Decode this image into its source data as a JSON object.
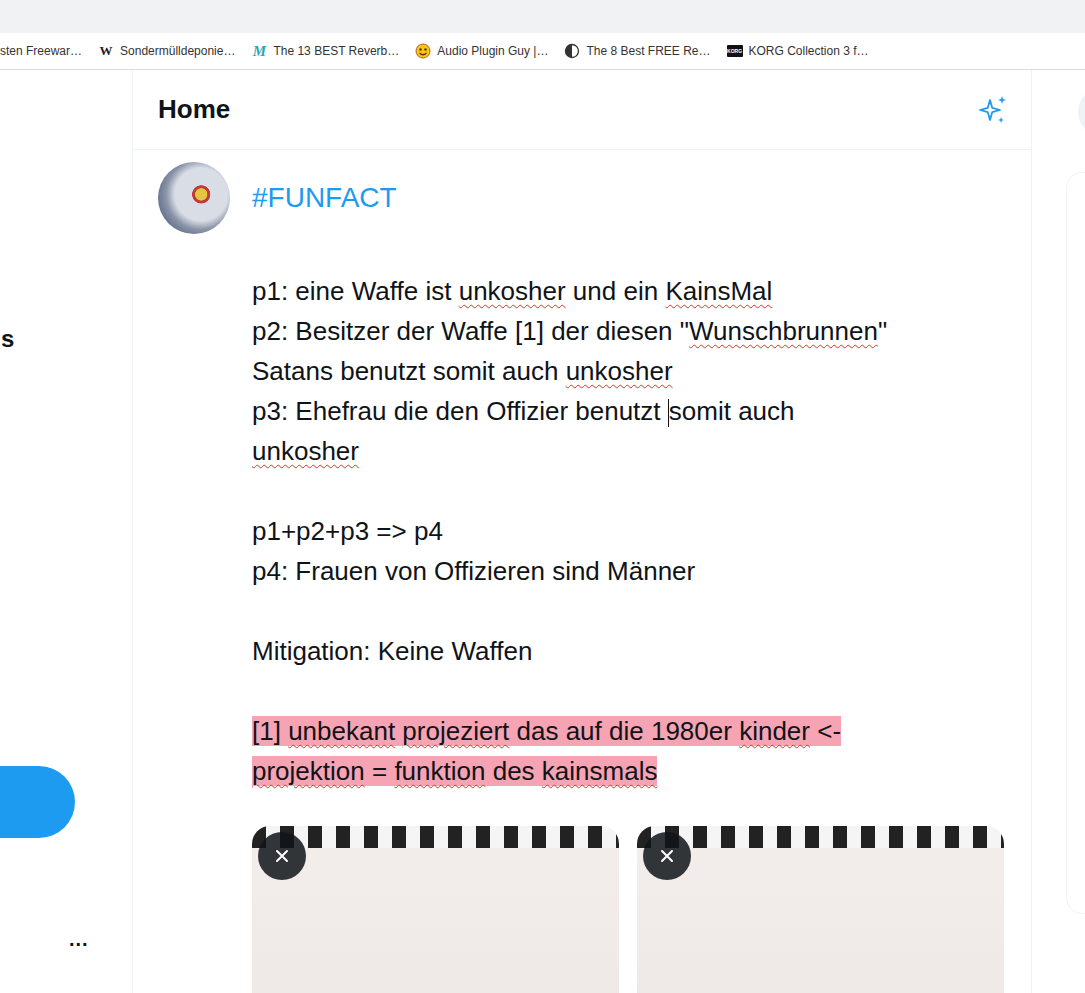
{
  "browser": {
    "bookmarks": [
      {
        "label": "sten Freewar…",
        "kind": "none",
        "icon_text": ""
      },
      {
        "label": "Sondermülldeponie…",
        "kind": "wikipedia",
        "icon_text": "W"
      },
      {
        "label": "The 13 BEST Reverb…",
        "kind": "logo-m",
        "icon_text": "M"
      },
      {
        "label": "Audio Plugin Guy |…",
        "kind": "emoji",
        "icon_text": ""
      },
      {
        "label": "The 8 Best FREE Re…",
        "kind": "half-moon",
        "icon_text": ""
      },
      {
        "label": "KORG Collection 3 f…",
        "kind": "korg",
        "icon_text": "KORG"
      }
    ]
  },
  "left_nav": {
    "partial_label": "s",
    "more": "..."
  },
  "header": {
    "title": "Home"
  },
  "post": {
    "hashtag": "#FUNFACT",
    "lines": [
      {
        "highlighted": false,
        "segments": [
          {
            "text": "p1: eine Waffe ist ",
            "misspelled": false,
            "caret": false
          },
          {
            "text": "unkosher",
            "misspelled": true,
            "caret": false
          },
          {
            "text": " und ein ",
            "misspelled": false,
            "caret": false
          },
          {
            "text": "KainsMal",
            "misspelled": true,
            "caret": false
          }
        ]
      },
      {
        "highlighted": false,
        "segments": [
          {
            "text": "p2: Besitzer der Waffe [1] der diesen \"",
            "misspelled": false,
            "caret": false
          },
          {
            "text": "Wunschbrunnen",
            "misspelled": true,
            "caret": false
          },
          {
            "text": "\"",
            "misspelled": false,
            "caret": false
          }
        ]
      },
      {
        "highlighted": false,
        "segments": [
          {
            "text": "Satans benutzt somit auch ",
            "misspelled": false,
            "caret": false
          },
          {
            "text": "unkosher",
            "misspelled": true,
            "caret": false
          }
        ]
      },
      {
        "highlighted": false,
        "segments": [
          {
            "text": "p3: Ehefrau die den Offizier benutzt ",
            "misspelled": false,
            "caret": false
          },
          {
            "text": "somit auch",
            "misspelled": false,
            "caret": true
          }
        ]
      },
      {
        "highlighted": false,
        "segments": [
          {
            "text": "unkosher",
            "misspelled": true,
            "caret": false
          }
        ]
      },
      {
        "highlighted": false,
        "segments": []
      },
      {
        "highlighted": false,
        "segments": [
          {
            "text": "p1+p2+p3 => p4",
            "misspelled": false,
            "caret": false
          }
        ]
      },
      {
        "highlighted": false,
        "segments": [
          {
            "text": "p4: Frauen von Offizieren sind Männer",
            "misspelled": false,
            "caret": false
          }
        ]
      },
      {
        "highlighted": false,
        "segments": []
      },
      {
        "highlighted": false,
        "segments": [
          {
            "text": "Mitigation: Keine Waffen",
            "misspelled": false,
            "caret": false
          }
        ]
      },
      {
        "highlighted": false,
        "segments": []
      },
      {
        "highlighted": true,
        "segments": [
          {
            "text": "[1] ",
            "misspelled": false,
            "caret": false
          },
          {
            "text": "unbekant",
            "misspelled": true,
            "caret": false
          },
          {
            "text": " ",
            "misspelled": false,
            "caret": false
          },
          {
            "text": "projeziert",
            "misspelled": true,
            "caret": false
          },
          {
            "text": " das auf die 1980er ",
            "misspelled": false,
            "caret": false
          },
          {
            "text": "kinder",
            "misspelled": true,
            "caret": false
          },
          {
            "text": " <-",
            "misspelled": false,
            "caret": false
          }
        ]
      },
      {
        "highlighted": true,
        "segments": [
          {
            "text": "projektion",
            "misspelled": true,
            "caret": false
          },
          {
            "text": " = ",
            "misspelled": false,
            "caret": false
          },
          {
            "text": "funktion",
            "misspelled": true,
            "caret": false
          },
          {
            "text": " des ",
            "misspelled": false,
            "caret": false
          },
          {
            "text": "kainsmals",
            "misspelled": true,
            "caret": false
          }
        ]
      }
    ],
    "attachments": [
      {
        "removable": true
      },
      {
        "removable": true
      }
    ]
  }
}
